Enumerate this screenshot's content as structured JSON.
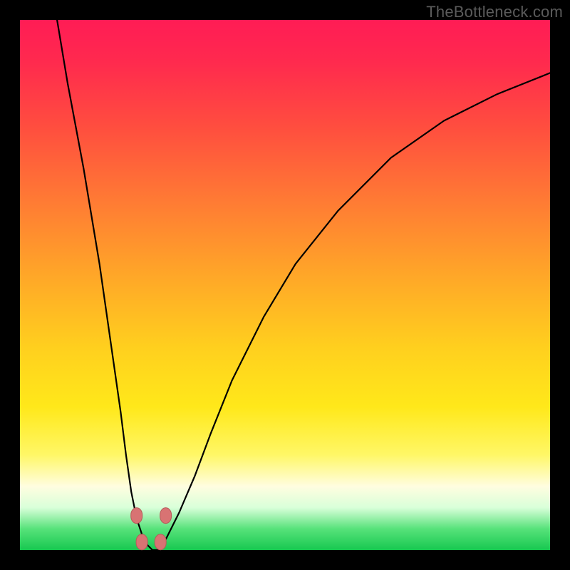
{
  "watermark": "TheBottleneck.com",
  "chart_data": {
    "type": "line",
    "title": "",
    "xlabel": "",
    "ylabel": "",
    "xlim": [
      0,
      100
    ],
    "ylim": [
      0,
      100
    ],
    "series": [
      {
        "name": "curve",
        "x": [
          7,
          9,
          12,
          15,
          17,
          19,
          20,
          21,
          22,
          23,
          24,
          25,
          26,
          27,
          28,
          30,
          33,
          36,
          40,
          46,
          52,
          60,
          70,
          80,
          90,
          100
        ],
        "values": [
          100,
          88,
          72,
          54,
          40,
          26,
          18,
          11,
          6,
          3,
          1,
          0,
          0,
          1,
          3,
          7,
          14,
          22,
          32,
          44,
          54,
          64,
          74,
          81,
          86,
          90
        ]
      }
    ],
    "markers": [
      {
        "x": 22.0,
        "y": 6.5
      },
      {
        "x": 27.5,
        "y": 6.5
      },
      {
        "x": 23.0,
        "y": 1.5
      },
      {
        "x": 26.5,
        "y": 1.5
      }
    ],
    "gradient_stops": [
      {
        "pct": 0,
        "color": "#ff1c55"
      },
      {
        "pct": 20,
        "color": "#ff4d3f"
      },
      {
        "pct": 48,
        "color": "#ffa628"
      },
      {
        "pct": 73,
        "color": "#ffe81a"
      },
      {
        "pct": 88,
        "color": "#fffde0"
      },
      {
        "pct": 96,
        "color": "#57e27a"
      },
      {
        "pct": 100,
        "color": "#17c850"
      }
    ]
  }
}
